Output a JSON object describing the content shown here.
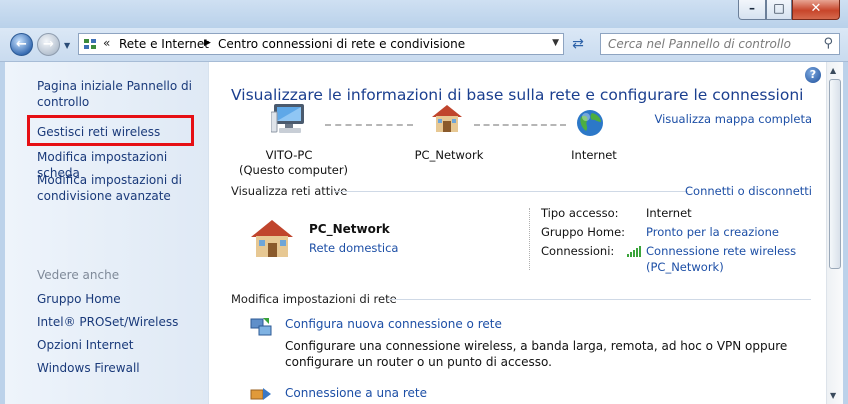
{
  "window": {
    "minimize_glyph": "–",
    "maximize_glyph": "□",
    "close_glyph": "✕"
  },
  "address_bar": {
    "separator": "«",
    "crumbs": [
      "Rete e Internet",
      "Centro connessioni di rete e condivisione"
    ]
  },
  "search": {
    "placeholder": "Cerca nel Pannello di controllo"
  },
  "sidebar": {
    "home": "Pagina iniziale Pannello di controllo",
    "tasks": [
      "Gestisci reti wireless",
      "Modifica impostazioni scheda",
      "Modifica impostazioni di condivisione avanzate"
    ],
    "see_also_heading": "Vedere anche",
    "see_also": [
      "Gruppo Home",
      "Intel® PROSet/Wireless",
      "Opzioni Internet",
      "Windows Firewall"
    ]
  },
  "main": {
    "title": "Visualizzare le informazioni di base sulla rete e configurare le connessioni",
    "full_map_link": "Visualizza mappa completa",
    "map": {
      "computer_name": "VITO-PC",
      "computer_sub": "(Questo computer)",
      "network_name": "PC_Network",
      "internet": "Internet"
    },
    "active_networks_heading": "Visualizza reti attive",
    "connect_link": "Connetti o disconnetti",
    "active_network": {
      "name": "PC_Network",
      "type": "Rete domestica",
      "access_label": "Tipo accesso:",
      "access_value": "Internet",
      "homegroup_label": "Gruppo Home:",
      "homegroup_value": "Pronto per la creazione",
      "connections_label": "Connessioni:",
      "connections_value_line1": "Connessione rete wireless",
      "connections_value_line2": "(PC_Network)"
    },
    "change_settings_heading": "Modifica impostazioni di rete",
    "tasks": [
      {
        "label": "Configura nuova connessione o rete",
        "description": "Configurare una connessione wireless, a banda larga, remota, ad hoc o VPN oppure configurare un router o un punto di accesso."
      },
      {
        "label": "Connessione a una rete"
      }
    ]
  },
  "colors": {
    "link": "#1d4fa6",
    "title": "#1b3f8f",
    "highlight_box": "#e60f14"
  }
}
